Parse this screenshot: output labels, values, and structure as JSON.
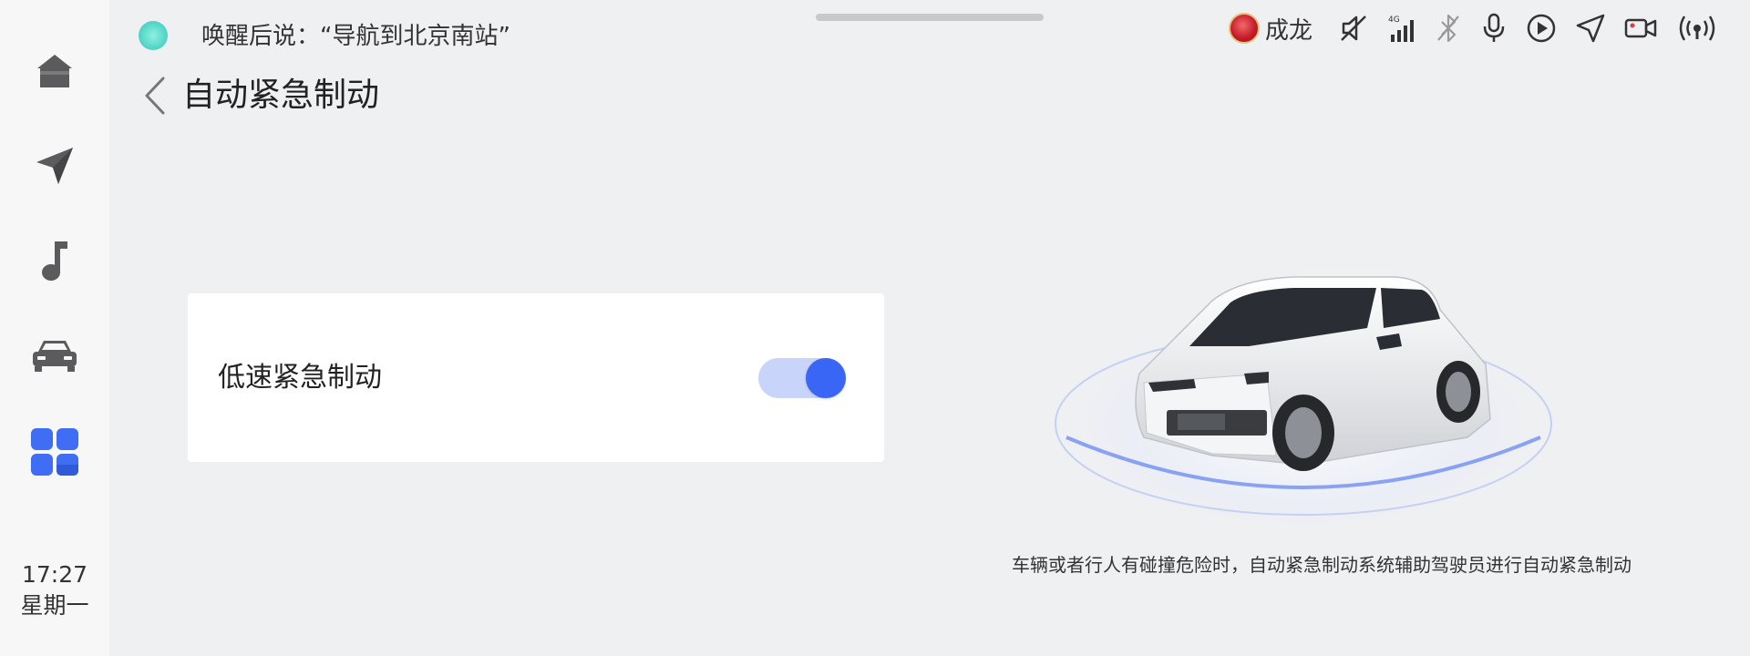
{
  "sidebar": {
    "items": [
      {
        "name": "home-icon"
      },
      {
        "name": "navigation-icon"
      },
      {
        "name": "music-icon"
      },
      {
        "name": "car-icon"
      },
      {
        "name": "apps-icon",
        "color": "#3f6df3"
      }
    ],
    "time": "17:27",
    "day": "星期一"
  },
  "voice": {
    "hint": "唤醒后说：“导航到北京南站”",
    "dot_color": "#5fdccd"
  },
  "status_bar": {
    "user_name": "成龙",
    "icons": [
      "avatar",
      "mute-icon",
      "signal-4g-icon",
      "bluetooth-off-icon",
      "microphone-icon",
      "play-icon",
      "location-icon",
      "camera-icon",
      "broadcast-icon"
    ],
    "signal_label": "4G"
  },
  "page": {
    "title": "自动紧急制动"
  },
  "setting": {
    "label": "低速紧急制动",
    "enabled": true,
    "accent": "#3a66f5"
  },
  "description": "车辆或者行人有碰撞危险时，自动紧急制动系统辅助驾驶员进行自动紧急制动"
}
